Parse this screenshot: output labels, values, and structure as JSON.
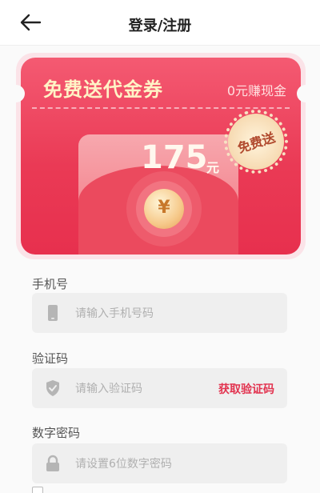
{
  "header": {
    "title": "登录/注册"
  },
  "banner": {
    "title": "免费送代金券",
    "subtitle": "0元赚现金",
    "amount": "175",
    "amount_unit": "元",
    "coin_symbol": "¥",
    "badge": "免费送"
  },
  "form": {
    "phone": {
      "label": "手机号",
      "placeholder": "请输入手机号码"
    },
    "code": {
      "label": "验证码",
      "placeholder": "请输入验证码",
      "get_code": "获取验证码"
    },
    "password": {
      "label": "数字密码",
      "placeholder": "请设置6位数字密码"
    }
  },
  "colors": {
    "accent": "#e2334f",
    "banner_red": "#ea3a55"
  },
  "icons": [
    "back-arrow-icon",
    "phone-icon",
    "shield-icon",
    "lock-icon"
  ]
}
